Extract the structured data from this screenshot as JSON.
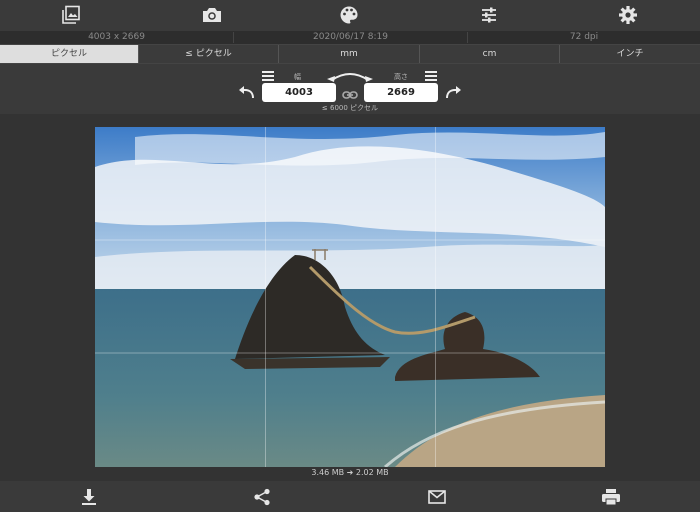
{
  "toolbar": {
    "buttons": [
      {
        "name": "photo-library-icon"
      },
      {
        "name": "camera-icon"
      },
      {
        "name": "palette-icon"
      },
      {
        "name": "sliders-icon"
      },
      {
        "name": "gear-icon"
      }
    ]
  },
  "info": {
    "dimensions": "4003 x 2669",
    "date": "2020/06/17 8:19",
    "dpi": "72 dpi"
  },
  "unit_tabs": [
    "ピクセル",
    "≤ ピクセル",
    "mm",
    "cm",
    "インチ"
  ],
  "active_tab": 0,
  "resize": {
    "width_label": "幅",
    "height_label": "高さ",
    "width_value": "4003",
    "height_value": "2669",
    "hint": "≤ 6000 ピクセル"
  },
  "file_size": "3.46 MB ➜ 2.02 MB",
  "bottom_actions": [
    "download-icon",
    "share-icon",
    "mail-icon",
    "print-icon"
  ],
  "colors": {
    "accent_bg": "#383838",
    "active_tab": "#dedede"
  }
}
